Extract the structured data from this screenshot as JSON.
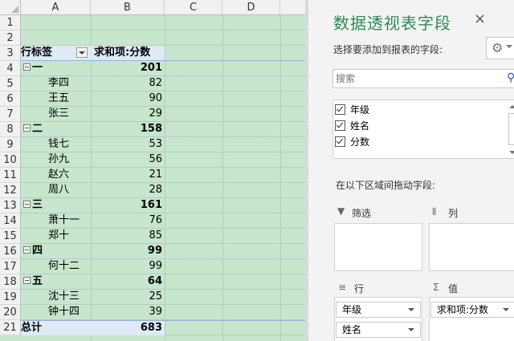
{
  "spreadsheet": {
    "columns": [
      "A",
      "B",
      "C",
      "D"
    ],
    "row_numbers": [
      "1",
      "2",
      "3",
      "4",
      "5",
      "6",
      "7",
      "8",
      "9",
      "10",
      "11",
      "12",
      "13",
      "14",
      "15",
      "16",
      "17",
      "18",
      "19",
      "20",
      "21"
    ],
    "pivot": {
      "header": {
        "row_label": "行标签",
        "value_label": "求和项:分数"
      },
      "rows": [
        {
          "label": "一",
          "value": "201",
          "type": "group"
        },
        {
          "label": "李四",
          "value": "82",
          "type": "item"
        },
        {
          "label": "王五",
          "value": "90",
          "type": "item"
        },
        {
          "label": "张三",
          "value": "29",
          "type": "item"
        },
        {
          "label": "二",
          "value": "158",
          "type": "group"
        },
        {
          "label": "钱七",
          "value": "53",
          "type": "item"
        },
        {
          "label": "孙九",
          "value": "56",
          "type": "item"
        },
        {
          "label": "赵六",
          "value": "21",
          "type": "item"
        },
        {
          "label": "周八",
          "value": "28",
          "type": "item"
        },
        {
          "label": "三",
          "value": "161",
          "type": "group"
        },
        {
          "label": "萧十一",
          "value": "76",
          "type": "item"
        },
        {
          "label": "郑十",
          "value": "85",
          "type": "item"
        },
        {
          "label": "四",
          "value": "99",
          "type": "group"
        },
        {
          "label": "何十二",
          "value": "99",
          "type": "item"
        },
        {
          "label": "五",
          "value": "64",
          "type": "group"
        },
        {
          "label": "沈十三",
          "value": "25",
          "type": "item"
        },
        {
          "label": "钟十四",
          "value": "39",
          "type": "item"
        }
      ],
      "total": {
        "label": "总计",
        "value": "683"
      }
    }
  },
  "pane": {
    "title": "数据透视表字段",
    "close": "×",
    "subtitle": "选择要添加到报表的字段:",
    "settings_icon": "gear-icon",
    "search_placeholder": "搜索",
    "fields": [
      {
        "label": "年级",
        "checked": true
      },
      {
        "label": "姓名",
        "checked": true
      },
      {
        "label": "分数",
        "checked": true
      }
    ],
    "drag_hint": "在以下区域间拖动字段:",
    "zones": {
      "filters": {
        "label": "筛选",
        "icon": "funnel-icon"
      },
      "columns": {
        "label": "列",
        "icon": "columns-icon"
      },
      "rows": {
        "label": "行",
        "icon": "rows-icon",
        "items": [
          "年级",
          "姓名"
        ]
      },
      "values": {
        "label": "值",
        "icon": "sigma-icon",
        "items": [
          "求和项:分数"
        ]
      }
    }
  },
  "colors": {
    "sheet_bg": "#c7e6cd",
    "pivot_header_bg": "#dfeaf6",
    "title_green": "#2f8a55"
  }
}
